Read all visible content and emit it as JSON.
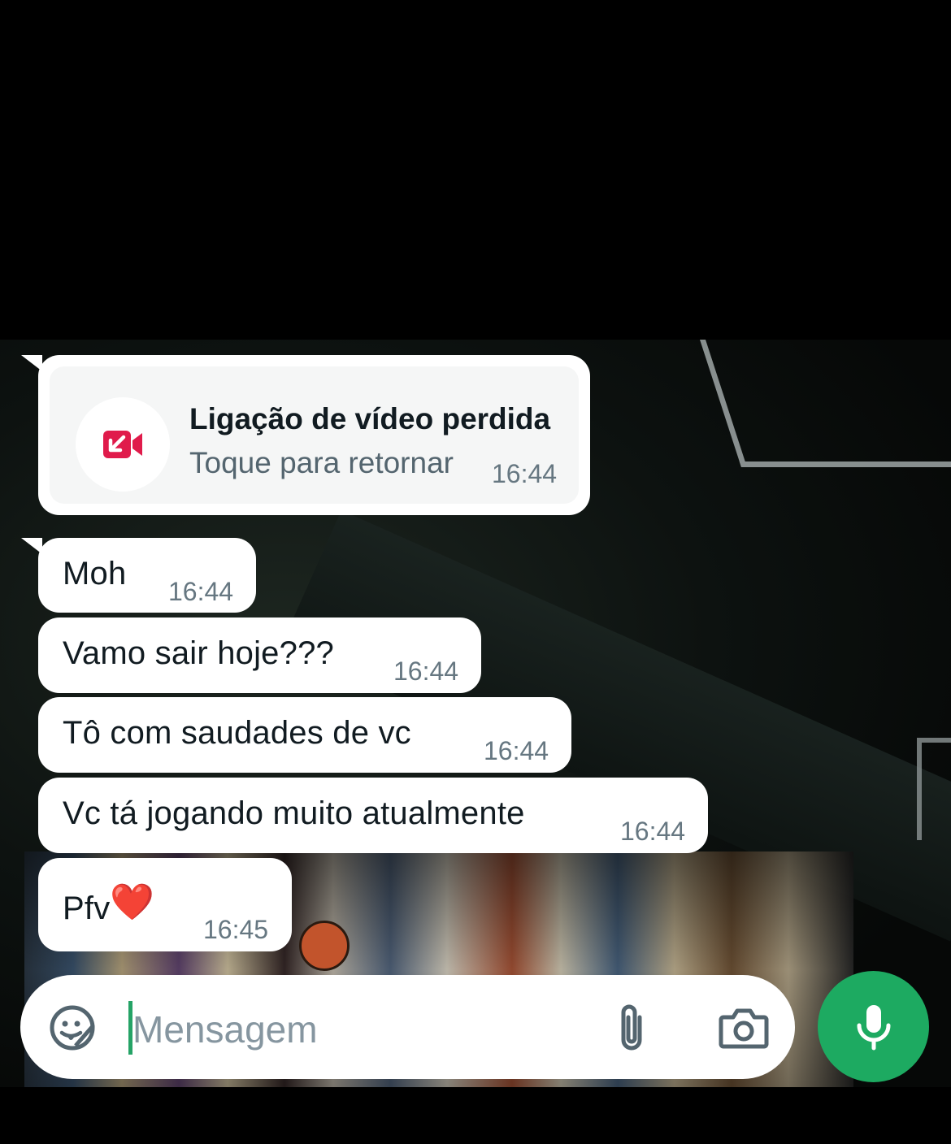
{
  "chat": {
    "missed_call": {
      "title": "Ligação de vídeo perdida",
      "subtitle": "Toque para retornar",
      "time": "16:44",
      "icon": "missed-video-call-icon",
      "icon_color": "#e01b4b"
    },
    "messages": [
      {
        "text": "Moh",
        "time": "16:44"
      },
      {
        "text": "Vamo sair hoje???",
        "time": "16:44"
      },
      {
        "text": "Tô com saudades de vc",
        "time": "16:44"
      },
      {
        "text": "Vc tá jogando muito atualmente",
        "time": "16:44"
      },
      {
        "text": "Pfv",
        "emoji": "❤️",
        "time": "16:45"
      }
    ]
  },
  "composer": {
    "placeholder": "Mensagem",
    "sticker_icon": "sticker-icon",
    "attach_icon": "paperclip-icon",
    "camera_icon": "camera-icon",
    "mic_icon": "microphone-icon",
    "accent_color": "#1daa61"
  }
}
